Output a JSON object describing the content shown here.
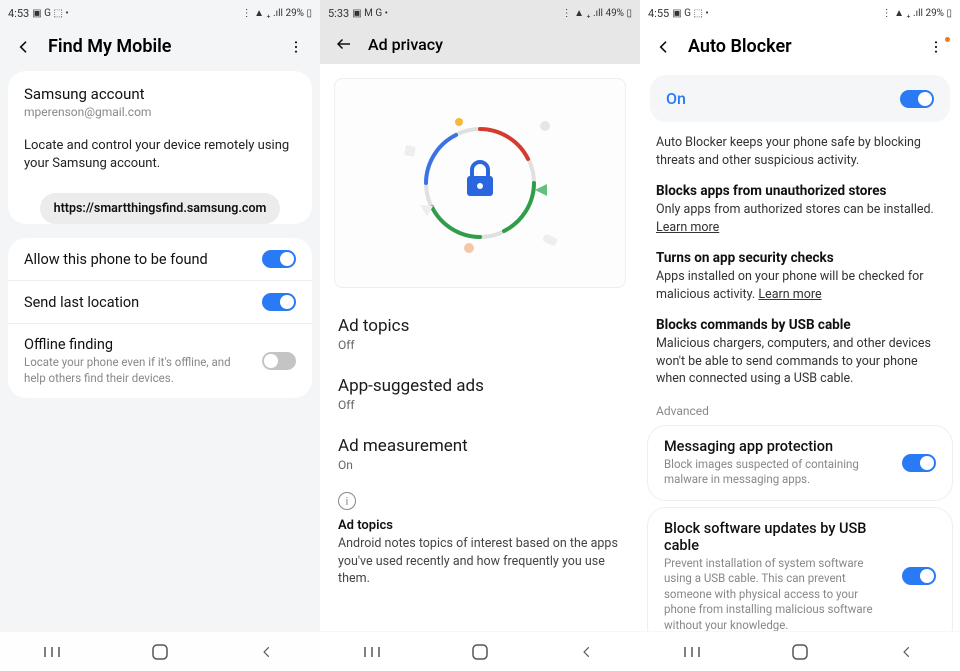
{
  "screens": {
    "left": {
      "status": {
        "time": "4:53",
        "icons": "▣ G ⬚ •",
        "right": "⋮ ▲ ₊ .ıll 29% ▯"
      },
      "title": "Find My Mobile",
      "account": {
        "title": "Samsung account",
        "email": "mperenson@gmail.com",
        "description": "Locate and control your device remotely using your Samsung account.",
        "url": "https://smartthingsfind.samsung.com"
      },
      "settings": [
        {
          "title": "Allow this phone to be found",
          "sub": "",
          "state": "on"
        },
        {
          "title": "Send last location",
          "sub": "",
          "state": "on"
        },
        {
          "title": "Offline finding",
          "sub": "Locate your phone even if it's offline, and help others find their devices.",
          "state": "off"
        }
      ]
    },
    "mid": {
      "status": {
        "time": "5:33",
        "icons": "▣ M G •",
        "right": "⋮ ▲ ₊ .ıll 49% ▯"
      },
      "title": "Ad privacy",
      "items": [
        {
          "title": "Ad topics",
          "sub": "Off"
        },
        {
          "title": "App-suggested ads",
          "sub": "Off"
        },
        {
          "title": "Ad measurement",
          "sub": "On"
        }
      ],
      "footnote": {
        "title": "Ad topics",
        "body": "Android notes topics of interest based on the apps you've used recently and how frequently you use them."
      }
    },
    "right": {
      "status": {
        "time": "4:55",
        "icons": "▣ G ⬚ •",
        "right": "⋮ ▲ ₊ .ıll 29% ▯"
      },
      "title": "Auto Blocker",
      "onLabel": "On",
      "desc": "Auto Blocker keeps your phone safe by blocking threats and other suspicious activity.",
      "sections": [
        {
          "title": "Blocks apps from unauthorized stores",
          "body": "Only apps from authorized stores can be installed.",
          "learn": "Learn more"
        },
        {
          "title": "Turns on app security checks",
          "body": "Apps installed on your phone will be checked for malicious activity.",
          "learn": "Learn more"
        },
        {
          "title": "Blocks commands by USB cable",
          "body": "Malicious chargers, computers, and other devices won't be able to send commands to your phone when connected using a USB cable.",
          "learn": ""
        }
      ],
      "advancedLabel": "Advanced",
      "advanced": [
        {
          "title": "Messaging app protection",
          "sub": "Block images suspected of containing malware in messaging apps.",
          "state": "on"
        },
        {
          "title": "Block software updates by USB cable",
          "sub": "Prevent installation of system software using a USB cable. This can prevent someone with physical access to your phone from installing malicious software without your knowledge.",
          "state": "on"
        }
      ]
    }
  }
}
